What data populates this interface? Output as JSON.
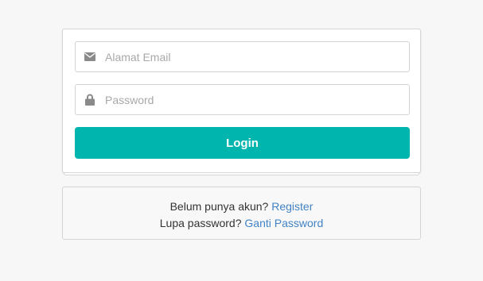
{
  "form": {
    "email": {
      "icon": "envelope-icon",
      "placeholder": "Alamat Email",
      "value": ""
    },
    "password": {
      "icon": "lock-icon",
      "placeholder": "Password",
      "value": ""
    },
    "login_label": "Login"
  },
  "message": {
    "register_prompt": "Belum punya akun?",
    "register_link": "Register",
    "reset_prompt": "Lupa password?",
    "reset_link": "Ganti Password"
  },
  "colors": {
    "accent": "#00b5ad",
    "link": "#4183c4",
    "background": "#f7f7f7"
  }
}
